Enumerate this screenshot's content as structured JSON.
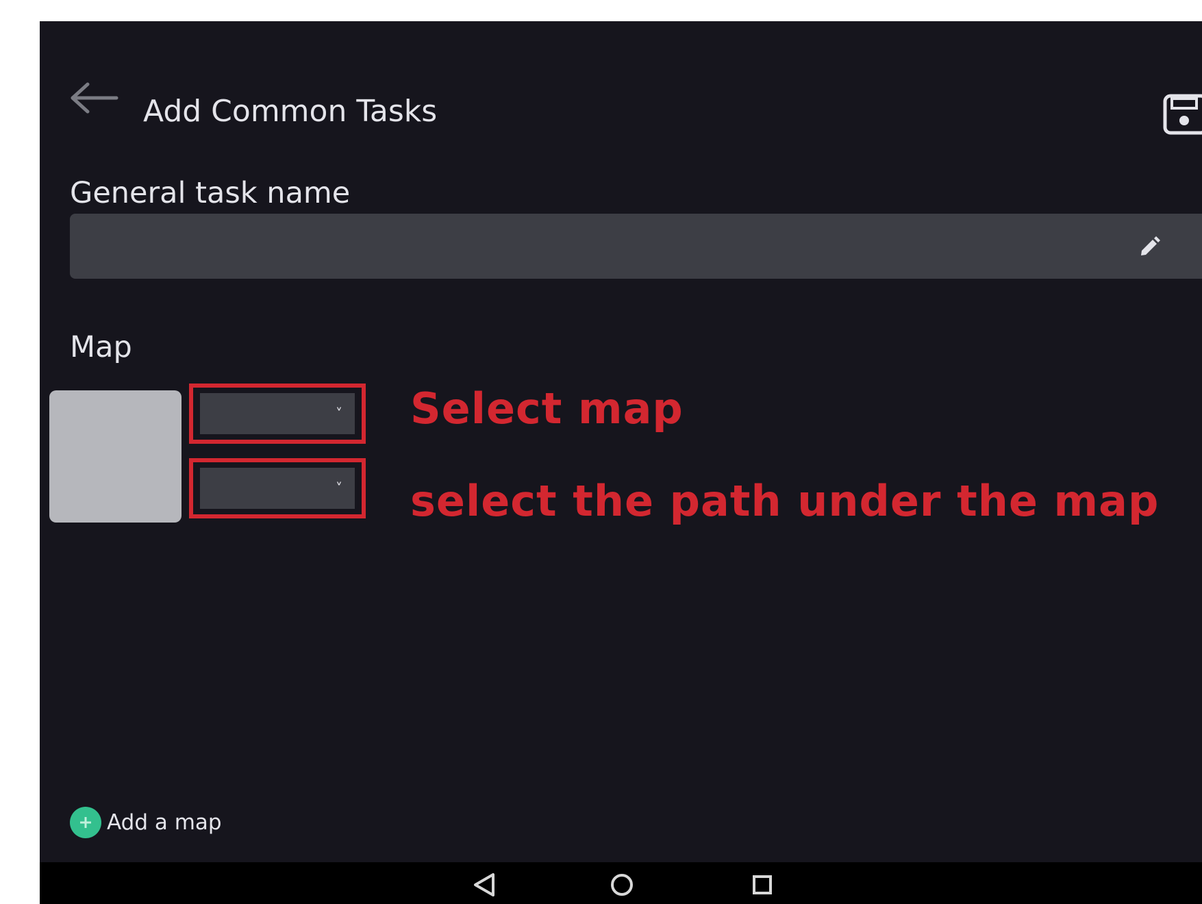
{
  "header": {
    "title": "Add Common Tasks",
    "back_icon": "arrow-left-icon",
    "save_icon": "floppy-disk-icon"
  },
  "task_name": {
    "label": "General task name",
    "value": "",
    "edit_icon": "pencil-icon"
  },
  "map_section": {
    "label": "Map",
    "map_select_value": "",
    "path_select_value": "",
    "dropdown_icon": "chevron-down-icon",
    "dropdown_glyph": "˅"
  },
  "annotations": {
    "select_map": "Select map",
    "select_path": "select the path under the map",
    "color": "#d32730"
  },
  "footer": {
    "add_map_label": "Add a map",
    "add_icon": "plus-circle-icon",
    "add_color": "#33c08e"
  },
  "system_nav": {
    "back": "triangle-back-icon",
    "home": "circle-home-icon",
    "recents": "square-recents-icon"
  },
  "colors": {
    "background": "#16151d",
    "field": "#3d3e45",
    "thumbnail": "#b6b7bc",
    "text": "#e4e4ea"
  }
}
